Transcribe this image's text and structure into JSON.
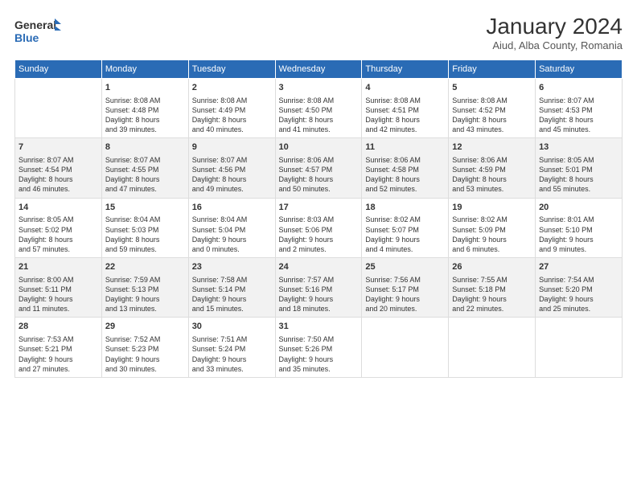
{
  "header": {
    "logo_line1": "General",
    "logo_line2": "Blue",
    "title": "January 2024",
    "subtitle": "Aiud, Alba County, Romania"
  },
  "days_of_week": [
    "Sunday",
    "Monday",
    "Tuesday",
    "Wednesday",
    "Thursday",
    "Friday",
    "Saturday"
  ],
  "weeks": [
    [
      {
        "day": "",
        "info": ""
      },
      {
        "day": "1",
        "info": "Sunrise: 8:08 AM\nSunset: 4:48 PM\nDaylight: 8 hours\nand 39 minutes."
      },
      {
        "day": "2",
        "info": "Sunrise: 8:08 AM\nSunset: 4:49 PM\nDaylight: 8 hours\nand 40 minutes."
      },
      {
        "day": "3",
        "info": "Sunrise: 8:08 AM\nSunset: 4:50 PM\nDaylight: 8 hours\nand 41 minutes."
      },
      {
        "day": "4",
        "info": "Sunrise: 8:08 AM\nSunset: 4:51 PM\nDaylight: 8 hours\nand 42 minutes."
      },
      {
        "day": "5",
        "info": "Sunrise: 8:08 AM\nSunset: 4:52 PM\nDaylight: 8 hours\nand 43 minutes."
      },
      {
        "day": "6",
        "info": "Sunrise: 8:07 AM\nSunset: 4:53 PM\nDaylight: 8 hours\nand 45 minutes."
      }
    ],
    [
      {
        "day": "7",
        "info": "Sunrise: 8:07 AM\nSunset: 4:54 PM\nDaylight: 8 hours\nand 46 minutes."
      },
      {
        "day": "8",
        "info": "Sunrise: 8:07 AM\nSunset: 4:55 PM\nDaylight: 8 hours\nand 47 minutes."
      },
      {
        "day": "9",
        "info": "Sunrise: 8:07 AM\nSunset: 4:56 PM\nDaylight: 8 hours\nand 49 minutes."
      },
      {
        "day": "10",
        "info": "Sunrise: 8:06 AM\nSunset: 4:57 PM\nDaylight: 8 hours\nand 50 minutes."
      },
      {
        "day": "11",
        "info": "Sunrise: 8:06 AM\nSunset: 4:58 PM\nDaylight: 8 hours\nand 52 minutes."
      },
      {
        "day": "12",
        "info": "Sunrise: 8:06 AM\nSunset: 4:59 PM\nDaylight: 8 hours\nand 53 minutes."
      },
      {
        "day": "13",
        "info": "Sunrise: 8:05 AM\nSunset: 5:01 PM\nDaylight: 8 hours\nand 55 minutes."
      }
    ],
    [
      {
        "day": "14",
        "info": "Sunrise: 8:05 AM\nSunset: 5:02 PM\nDaylight: 8 hours\nand 57 minutes."
      },
      {
        "day": "15",
        "info": "Sunrise: 8:04 AM\nSunset: 5:03 PM\nDaylight: 8 hours\nand 59 minutes."
      },
      {
        "day": "16",
        "info": "Sunrise: 8:04 AM\nSunset: 5:04 PM\nDaylight: 9 hours\nand 0 minutes."
      },
      {
        "day": "17",
        "info": "Sunrise: 8:03 AM\nSunset: 5:06 PM\nDaylight: 9 hours\nand 2 minutes."
      },
      {
        "day": "18",
        "info": "Sunrise: 8:02 AM\nSunset: 5:07 PM\nDaylight: 9 hours\nand 4 minutes."
      },
      {
        "day": "19",
        "info": "Sunrise: 8:02 AM\nSunset: 5:09 PM\nDaylight: 9 hours\nand 6 minutes."
      },
      {
        "day": "20",
        "info": "Sunrise: 8:01 AM\nSunset: 5:10 PM\nDaylight: 9 hours\nand 9 minutes."
      }
    ],
    [
      {
        "day": "21",
        "info": "Sunrise: 8:00 AM\nSunset: 5:11 PM\nDaylight: 9 hours\nand 11 minutes."
      },
      {
        "day": "22",
        "info": "Sunrise: 7:59 AM\nSunset: 5:13 PM\nDaylight: 9 hours\nand 13 minutes."
      },
      {
        "day": "23",
        "info": "Sunrise: 7:58 AM\nSunset: 5:14 PM\nDaylight: 9 hours\nand 15 minutes."
      },
      {
        "day": "24",
        "info": "Sunrise: 7:57 AM\nSunset: 5:16 PM\nDaylight: 9 hours\nand 18 minutes."
      },
      {
        "day": "25",
        "info": "Sunrise: 7:56 AM\nSunset: 5:17 PM\nDaylight: 9 hours\nand 20 minutes."
      },
      {
        "day": "26",
        "info": "Sunrise: 7:55 AM\nSunset: 5:18 PM\nDaylight: 9 hours\nand 22 minutes."
      },
      {
        "day": "27",
        "info": "Sunrise: 7:54 AM\nSunset: 5:20 PM\nDaylight: 9 hours\nand 25 minutes."
      }
    ],
    [
      {
        "day": "28",
        "info": "Sunrise: 7:53 AM\nSunset: 5:21 PM\nDaylight: 9 hours\nand 27 minutes."
      },
      {
        "day": "29",
        "info": "Sunrise: 7:52 AM\nSunset: 5:23 PM\nDaylight: 9 hours\nand 30 minutes."
      },
      {
        "day": "30",
        "info": "Sunrise: 7:51 AM\nSunset: 5:24 PM\nDaylight: 9 hours\nand 33 minutes."
      },
      {
        "day": "31",
        "info": "Sunrise: 7:50 AM\nSunset: 5:26 PM\nDaylight: 9 hours\nand 35 minutes."
      },
      {
        "day": "",
        "info": ""
      },
      {
        "day": "",
        "info": ""
      },
      {
        "day": "",
        "info": ""
      }
    ]
  ]
}
